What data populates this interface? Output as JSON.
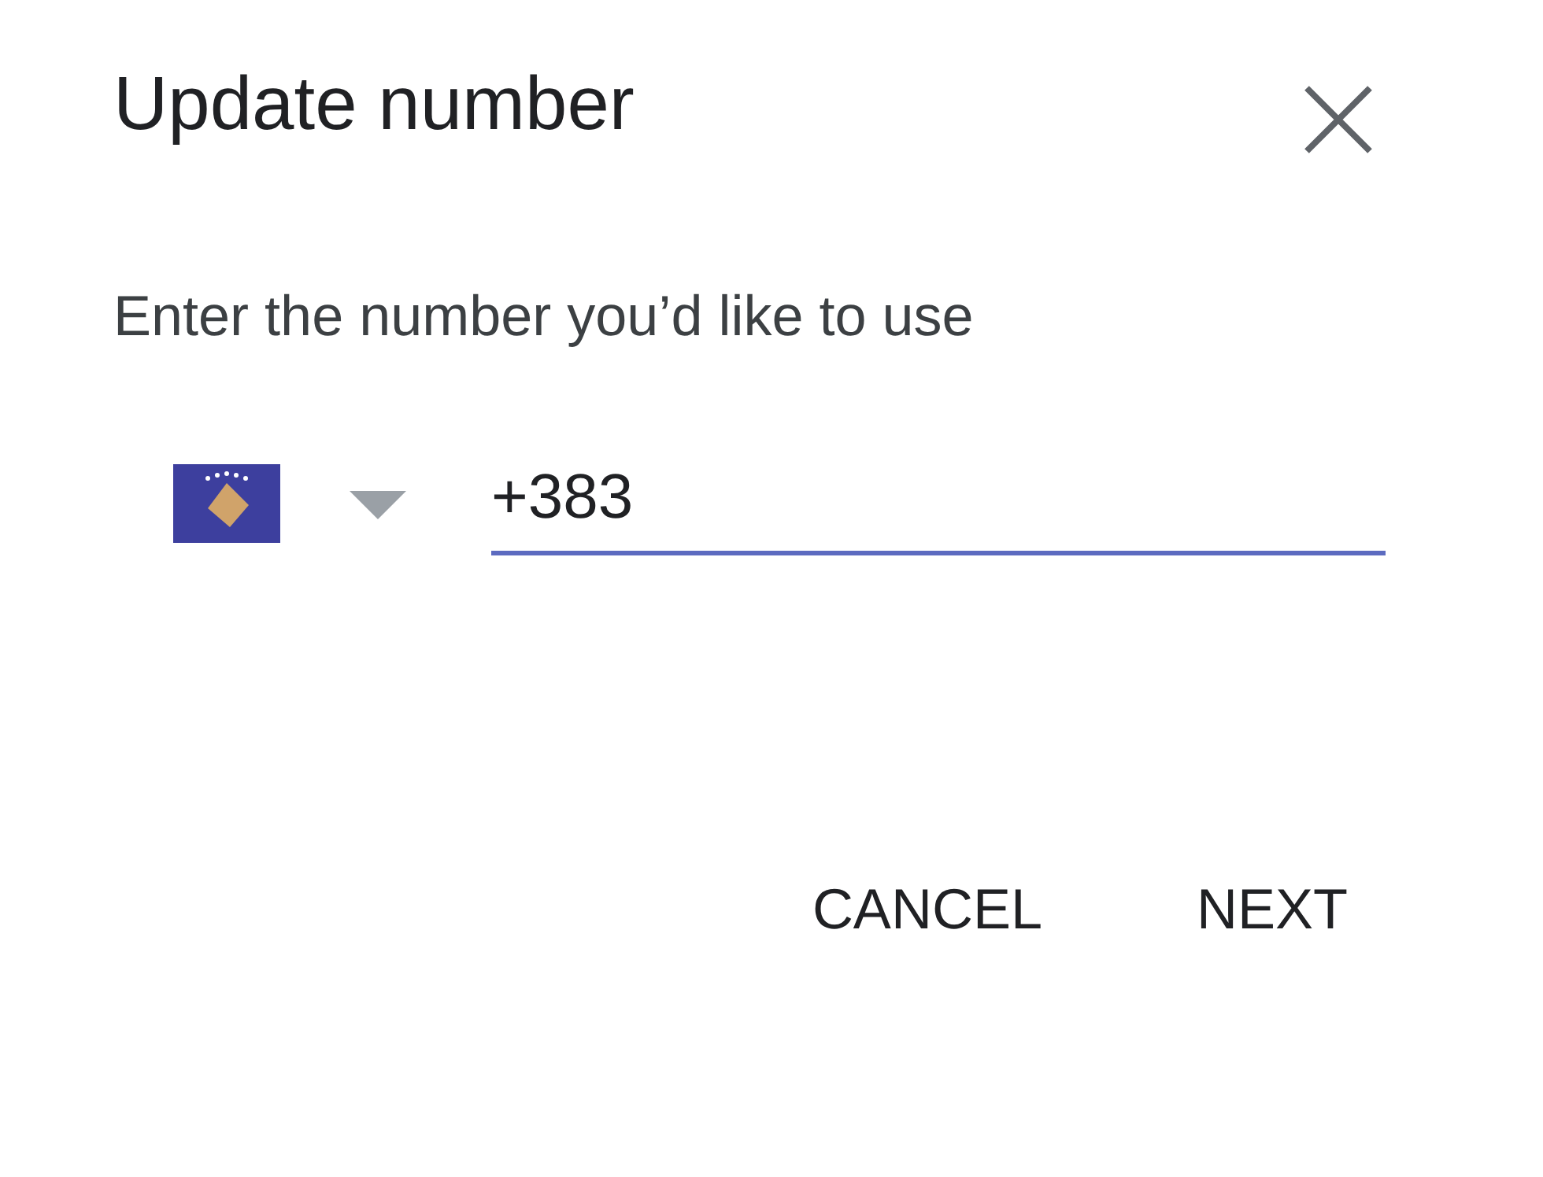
{
  "dialog": {
    "title": "Update number",
    "prompt": "Enter the number you’d like to use",
    "phone_field": {
      "value": "+383"
    },
    "buttons": [
      "CANCEL",
      "NEXT"
    ]
  }
}
